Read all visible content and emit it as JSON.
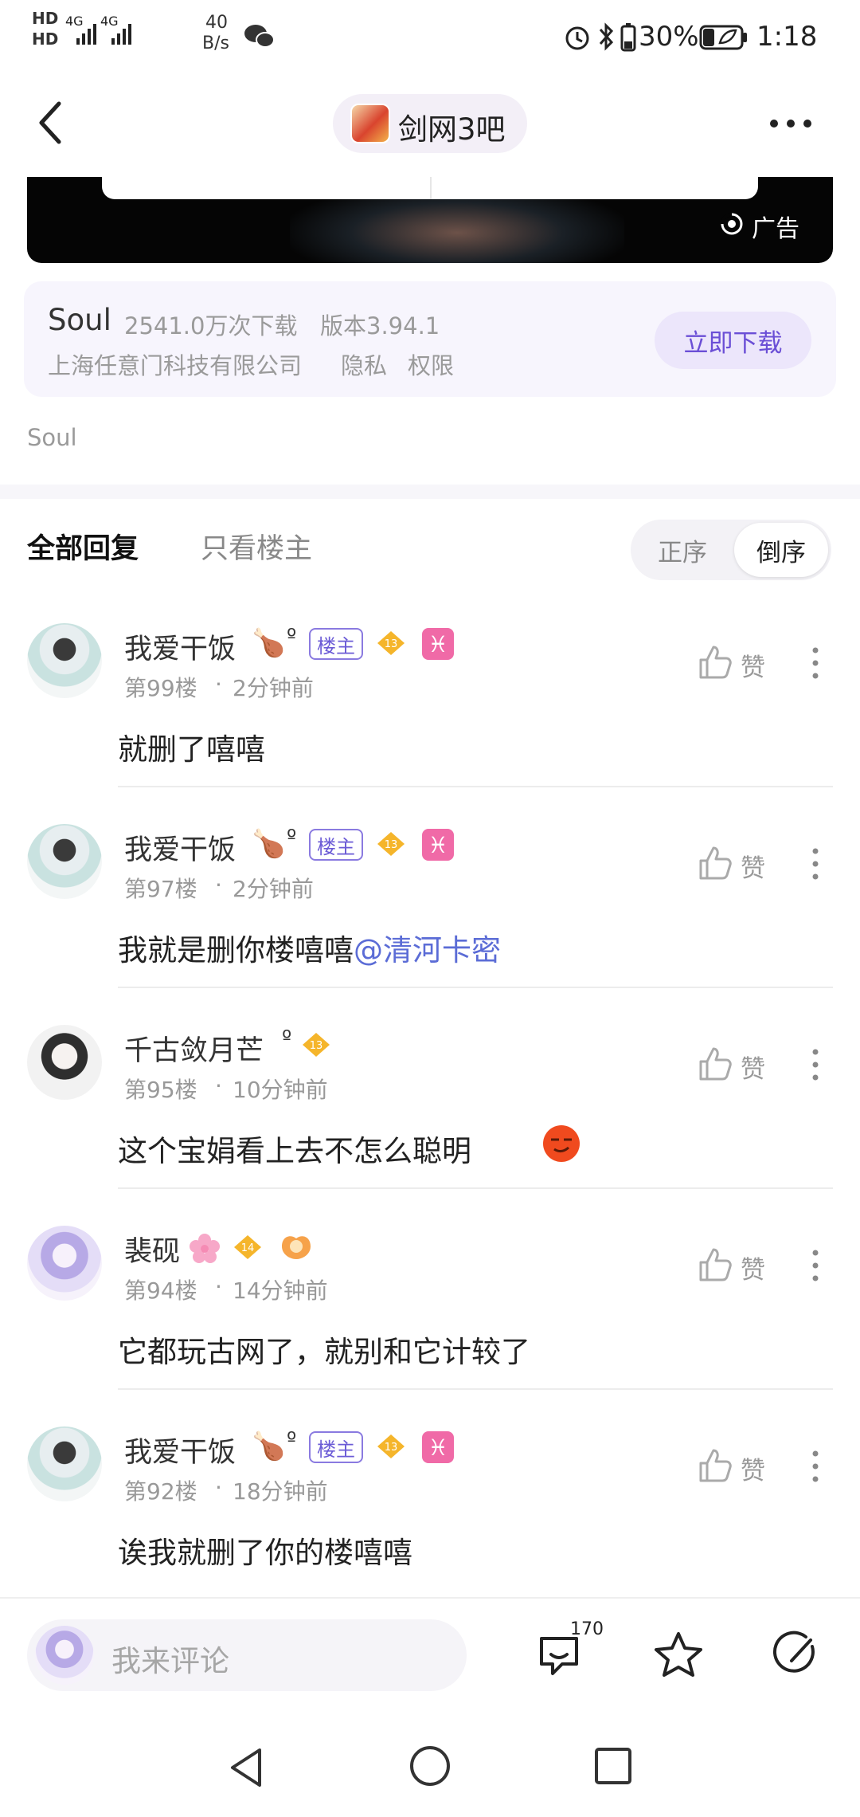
{
  "status_bar": {
    "hd1": "HD",
    "hd2": "HD",
    "net1": "4G",
    "net2": "4G",
    "speed_value": "40",
    "speed_unit": "B/s",
    "battery": "30%",
    "time": "1:18"
  },
  "header": {
    "title": "剑网3吧"
  },
  "ad": {
    "label": "广告",
    "app_name": "Soul",
    "downloads": "2541.0万次下载",
    "version": "版本3.94.1",
    "company": "上海任意门科技有限公司",
    "privacy": "隐私",
    "permissions": "权限",
    "download_button": "立即下载",
    "caption": "Soul"
  },
  "tabs": {
    "all": "全部回复",
    "owner_only": "只看楼主",
    "sort_asc": "正序",
    "sort_desc": "倒序"
  },
  "like_label": "赞",
  "comments": [
    {
      "name": "我爱干饭",
      "suffix": "º",
      "owner_badge": "楼主",
      "level": "13",
      "zodiac": "♓",
      "floor": "第99楼",
      "time": "2分钟前",
      "text": "就删了嘻嘻"
    },
    {
      "name": "我爱干饭",
      "suffix": "º",
      "owner_badge": "楼主",
      "level": "13",
      "zodiac": "♓",
      "floor": "第97楼",
      "time": "2分钟前",
      "text": "我就是删你楼嘻嘻",
      "mention": "@清河卡密"
    },
    {
      "name": "千古敛月芒",
      "suffix": "º",
      "level": "13",
      "floor": "第95楼",
      "time": "10分钟前",
      "text": "这个宝娟看上去不怎么聪明"
    },
    {
      "name": "裴砚",
      "level": "14",
      "floor": "第94楼",
      "time": "14分钟前",
      "text": "它都玩古网了，就别和它计较了"
    },
    {
      "name": "我爱干饭",
      "suffix": "º",
      "owner_badge": "楼主",
      "level": "13",
      "zodiac": "♓",
      "floor": "第92楼",
      "time": "18分钟前",
      "text": "诶我就删了你的楼嘻嘻"
    }
  ],
  "bottom_bar": {
    "placeholder": "我来评论",
    "comment_count": "170"
  },
  "colors": {
    "accent": "#6b4fd6",
    "mention": "#5b6cd6",
    "zodiac": "#f06aa7",
    "level_badge": "#f5b52b"
  }
}
